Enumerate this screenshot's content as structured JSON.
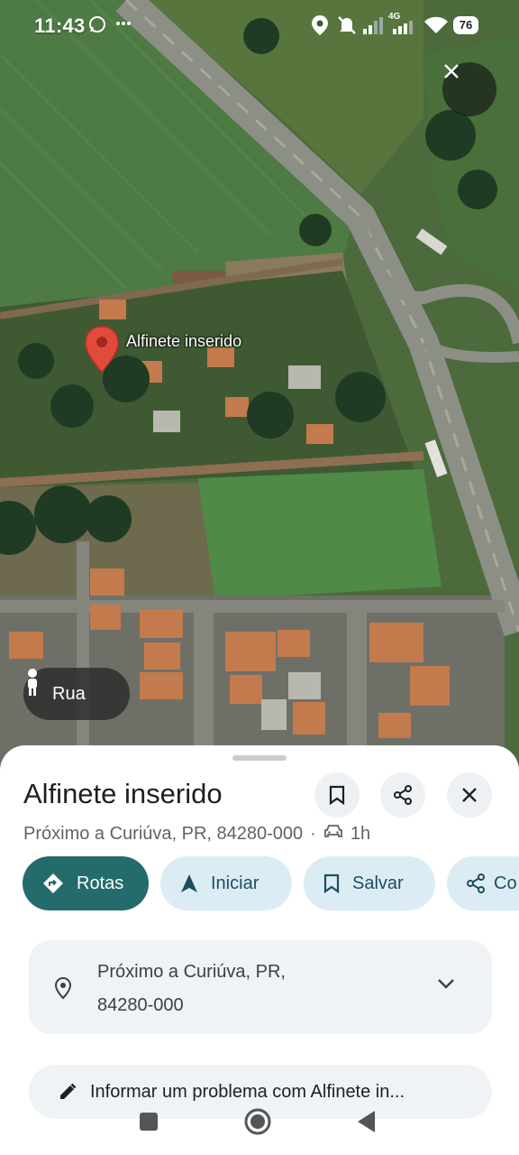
{
  "status_bar": {
    "time": "11:43",
    "network": "4G",
    "battery": "76",
    "icons": [
      "whatsapp-icon",
      "more-icon",
      "location-icon",
      "mute-icon",
      "signal-icon",
      "wifi-icon",
      "battery-icon"
    ]
  },
  "map": {
    "pin_label": "Alfinete inserido",
    "street_view_label": "Rua"
  },
  "place": {
    "title": "Alfinete inserido",
    "near": "Próximo a Curiúva, PR, 84280-000",
    "separator": "·",
    "drive_time": "1h"
  },
  "actions": {
    "routes": "Rotas",
    "start": "Iniciar",
    "save": "Salvar",
    "share": "Co"
  },
  "address": {
    "line1": "Próximo a Curiúva, PR,",
    "line2": "84280-000"
  },
  "report": {
    "label": "Informar um problema com Alfinete in..."
  },
  "colors": {
    "primary": "#246b6b",
    "tonal": "#dcecf5",
    "pin": "#e24a3b"
  }
}
